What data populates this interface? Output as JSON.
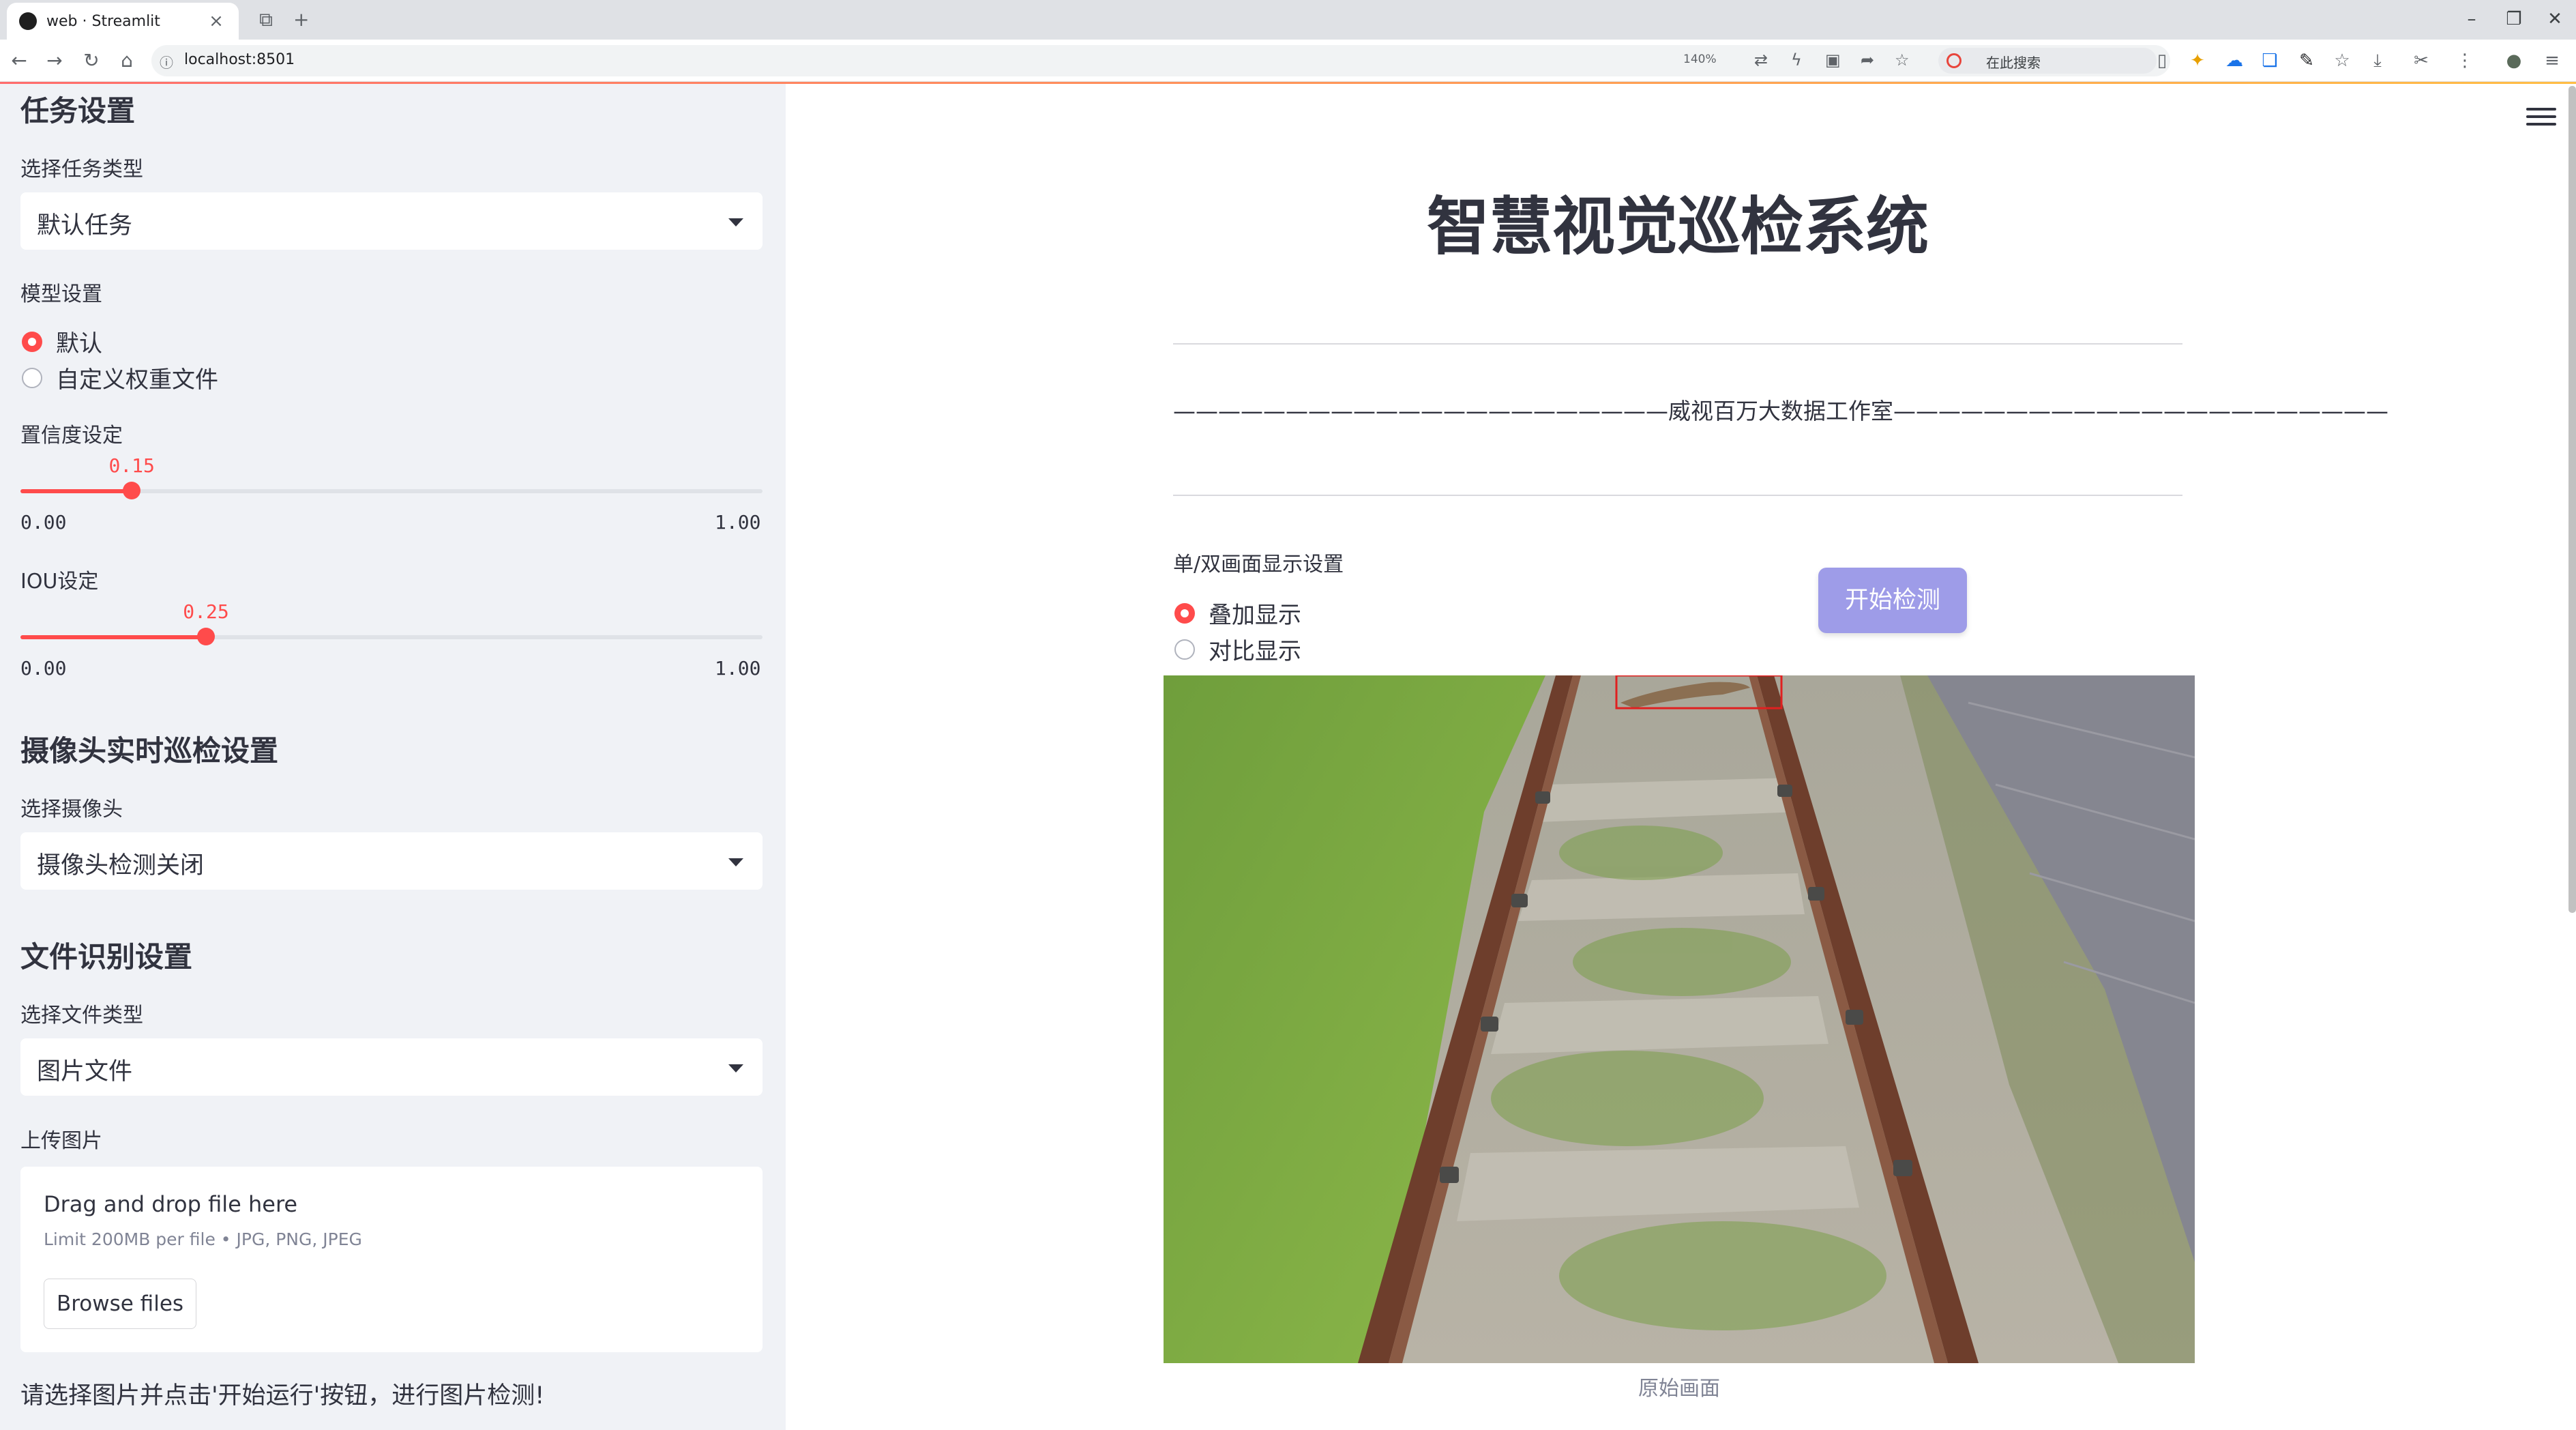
{
  "browser": {
    "tab_title": "web · Streamlit",
    "url": "localhost:8501",
    "zoom": "140%",
    "search_placeholder": "在此搜索"
  },
  "sidebar": {
    "task_header": "任务设置",
    "task_type_label": "选择任务类型",
    "task_type_value": "默认任务",
    "model_label": "模型设置",
    "model_options": [
      "默认",
      "自定义权重文件"
    ],
    "model_selected": "默认",
    "conf_label": "置信度设定",
    "conf_value": "0.15",
    "conf_min": "0.00",
    "conf_max": "1.00",
    "conf_fraction": 0.15,
    "iou_label": "IOU设定",
    "iou_value": "0.25",
    "iou_min": "0.00",
    "iou_max": "1.00",
    "iou_fraction": 0.25,
    "camera_header": "摄像头实时巡检设置",
    "camera_label": "选择摄像头",
    "camera_value": "摄像头检测关闭",
    "file_header": "文件识别设置",
    "file_type_label": "选择文件类型",
    "file_type_value": "图片文件",
    "upload_label": "上传图片",
    "upload_title": "Drag and drop file here",
    "upload_limit": "Limit 200MB per file • JPG, PNG, JPEG",
    "browse_label": "Browse files",
    "hint": "请选择图片并点击'开始运行'按钮，进行图片检测!"
  },
  "main": {
    "title": "智慧视觉巡检系统",
    "studio_line": "——————————————————————威视百万大数据工作室——————————————————————",
    "display_mode_label": "单/双画面显示设置",
    "display_options": [
      "叠加显示",
      "对比显示"
    ],
    "display_selected": "叠加显示",
    "start_button": "开始检测",
    "image_caption": "原始画面"
  },
  "colors": {
    "accent": "#ff4b4b",
    "button": "#9e9ce8",
    "sidebar_bg": "#f0f2f6",
    "detection_box": "#e02020"
  }
}
